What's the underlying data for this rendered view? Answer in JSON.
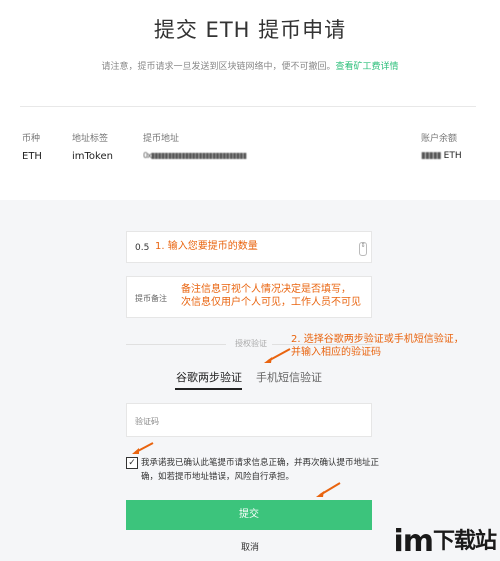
{
  "header": {
    "title": "提交 ETH 提币申请",
    "notice": "请注意，提币请求一旦发送到区块链网络中，便不可撤回。",
    "fee_link": "查看矿工费详情"
  },
  "account_table": {
    "columns": [
      "币种",
      "地址标签",
      "提币地址",
      "账户余额"
    ],
    "row": {
      "currency": "ETH",
      "address_label": "imToken",
      "address": "0x▮▮▮▮▮▮▮▮▮▮▮▮▮▮▮▮▮▮▮▮▮▮▮▮▮▮▮▮",
      "balance_amount": "▮▮▮▮▮",
      "balance_unit": "ETH"
    }
  },
  "form": {
    "amount_value": "0.5",
    "amount_annotation": "1. 输入您要提币的数量",
    "memo_label": "提币备注",
    "memo_annotation_line1": "备注信息可视个人情况决定是否填写，",
    "memo_annotation_line2": "次信息仅用户个人可见，工作人员不可见",
    "auth_label": "授权验证",
    "auth_annotation_line1": "2. 选择谷歌两步验证或手机短信验证，",
    "auth_annotation_line2": "并输入相应的验证码",
    "tabs": [
      "谷歌两步验证",
      "手机短信验证"
    ],
    "code_placeholder": "验证码",
    "consent_text": "我承诺我已确认此笔提币请求信息正确，并再次确认提币地址正确，如若提币地址错误，风险自行承担。",
    "consent_checked": true,
    "submit_label": "提交",
    "cancel_label": "取消"
  },
  "watermark": {
    "latin": "im",
    "cn": "下载站"
  },
  "colors": {
    "accent_green": "#3cc47c",
    "annotation_orange": "#e9640f"
  },
  "icons": [
    "arrow-annotation-icon",
    "checkbox-checked-icon",
    "spinner-icon"
  ]
}
